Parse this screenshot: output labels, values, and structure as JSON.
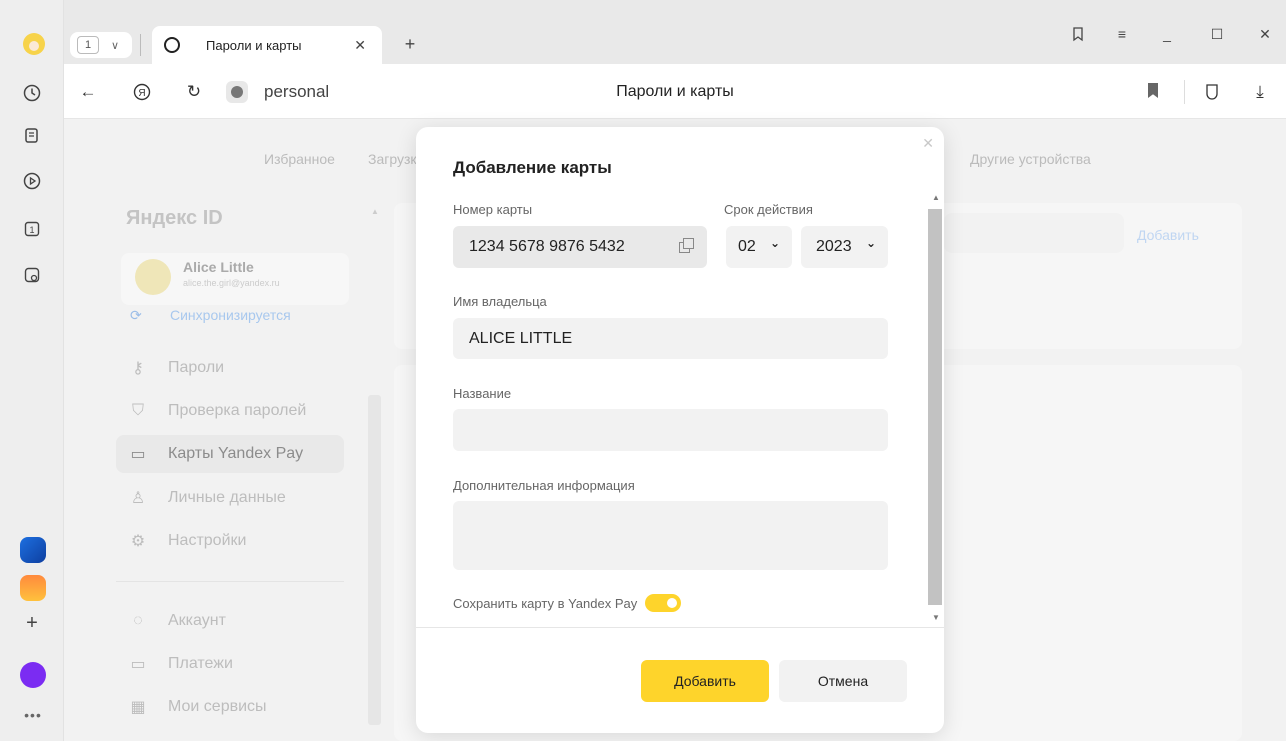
{
  "browser": {
    "tab_count": "1",
    "tab_title": "Пароли и карты",
    "url": "personal",
    "page_title": "Пароли и карты"
  },
  "page": {
    "nav_tabs": [
      "Избранное",
      "Загрузки",
      "Другие устройства"
    ],
    "logo": "Яндекс ID",
    "profile_name": "Alice Little",
    "profile_email": "alice.the.girl@yandex.ru",
    "sync_status": "Синхронизируется",
    "menu": [
      {
        "label": "Пароли",
        "icon": "key-icon"
      },
      {
        "label": "Проверка паролей",
        "icon": "shield-icon"
      },
      {
        "label": "Карты Yandex Pay",
        "icon": "card-icon"
      },
      {
        "label": "Личные данные",
        "icon": "person-icon"
      },
      {
        "label": "Настройки",
        "icon": "gear-icon"
      },
      {
        "label": "Аккаунт",
        "icon": "account-icon"
      },
      {
        "label": "Платежи",
        "icon": "payments-icon"
      },
      {
        "label": "Мои сервисы",
        "icon": "services-icon"
      }
    ],
    "active_menu": "Карты Yandex Pay",
    "add_link": "Добавить"
  },
  "dialog": {
    "title": "Добавление карты",
    "card_number_label": "Номер карты",
    "card_number_value": "1234 5678 9876 5432",
    "expiry_label": "Срок действия",
    "expiry_month": "02",
    "expiry_year": "2023",
    "holder_label": "Имя владельца",
    "holder_value": "ALICE LITTLE",
    "name_label": "Название",
    "name_value": "",
    "extra_label": "Дополнительная информация",
    "extra_value": "",
    "save_toggle_label": "Сохранить карту в Yandex Pay",
    "save_toggle_on": true,
    "add_button": "Добавить",
    "cancel_button": "Отмена"
  },
  "colors": {
    "accent": "#fed42b",
    "sync": "#a8c8ee"
  }
}
